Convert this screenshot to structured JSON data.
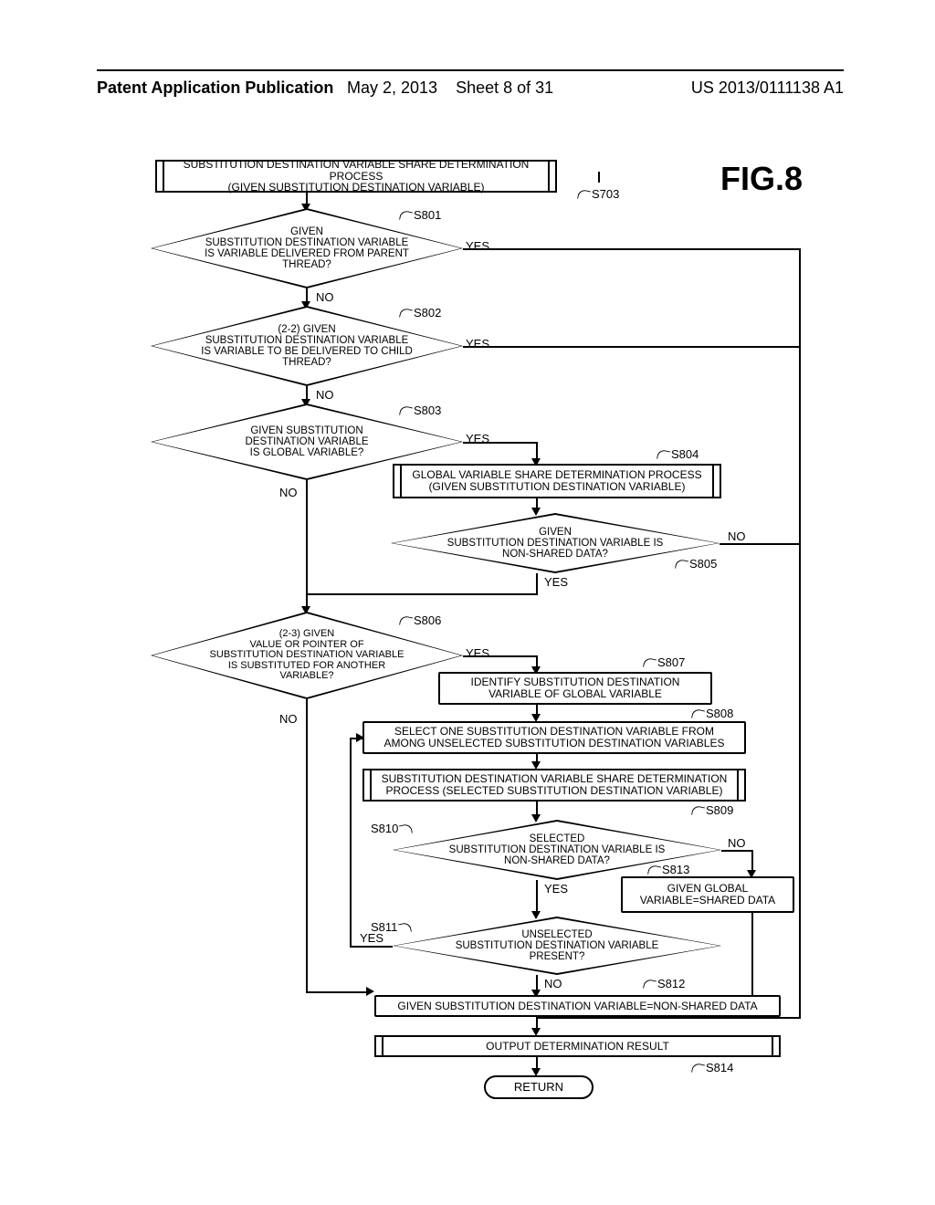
{
  "header": {
    "left": "Patent Application Publication",
    "date": "May 2, 2013",
    "sheet": "Sheet 8 of 31",
    "pubno": "US 2013/0111138 A1"
  },
  "figure_title": "FIG.8",
  "nodes": {
    "start": "SUBSTITUTION DESTINATION VARIABLE SHARE DETERMINATION PROCESS\n(GIVEN SUBSTITUTION DESTINATION VARIABLE)",
    "d801": "GIVEN\nSUBSTITUTION DESTINATION VARIABLE\nIS VARIABLE DELIVERED FROM PARENT\nTHREAD?",
    "d802": "(2-2) GIVEN\nSUBSTITUTION DESTINATION VARIABLE\nIS VARIABLE TO BE DELIVERED TO CHILD\nTHREAD?",
    "d803": "GIVEN SUBSTITUTION\nDESTINATION VARIABLE\nIS GLOBAL VARIABLE?",
    "p804": "GLOBAL VARIABLE SHARE DETERMINATION PROCESS\n(GIVEN SUBSTITUTION DESTINATION VARIABLE)",
    "d805": "GIVEN\nSUBSTITUTION DESTINATION VARIABLE IS\nNON-SHARED DATA?",
    "d806": "(2-3) GIVEN\nVALUE OR POINTER OF\nSUBSTITUTION DESTINATION VARIABLE\nIS SUBSTITUTED FOR ANOTHER\nVARIABLE?",
    "p807": "IDENTIFY SUBSTITUTION DESTINATION\nVARIABLE OF GLOBAL VARIABLE",
    "p808": "SELECT ONE SUBSTITUTION DESTINATION VARIABLE FROM\nAMONG UNSELECTED SUBSTITUTION DESTINATION VARIABLES",
    "p809": "SUBSTITUTION DESTINATION VARIABLE SHARE DETERMINATION\nPROCESS (SELECTED SUBSTITUTION DESTINATION VARIABLE)",
    "d810": "SELECTED\nSUBSTITUTION DESTINATION VARIABLE IS\nNON-SHARED DATA?",
    "d811": "UNSELECTED\nSUBSTITUTION DESTINATION VARIABLE\nPRESENT?",
    "p812": "GIVEN SUBSTITUTION DESTINATION VARIABLE=NON-SHARED DATA",
    "p813": "GIVEN GLOBAL\nVARIABLE=SHARED DATA",
    "p814": "OUTPUT DETERMINATION RESULT",
    "return": "RETURN"
  },
  "labels": {
    "yes": "YES",
    "no": "NO"
  },
  "steps": {
    "s703": "S703",
    "s801": "S801",
    "s802": "S802",
    "s803": "S803",
    "s804": "S804",
    "s805": "S805",
    "s806": "S806",
    "s807": "S807",
    "s808": "S808",
    "s809": "S809",
    "s810": "S810",
    "s811": "S811",
    "s812": "S812",
    "s813": "S813",
    "s814": "S814"
  }
}
